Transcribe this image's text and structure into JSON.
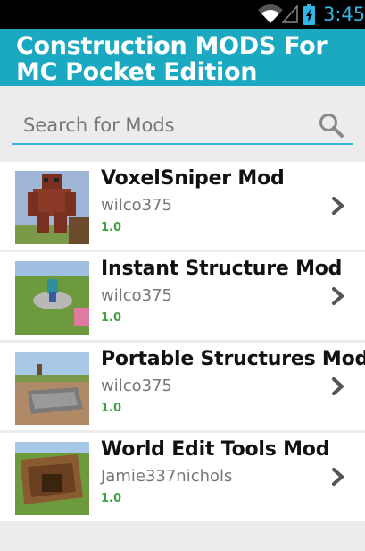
{
  "status_bar": {
    "time": "3:45"
  },
  "app_bar": {
    "title": "Construction MODS For MC Pocket Edition"
  },
  "search": {
    "placeholder": "Search for Mods"
  },
  "mods": [
    {
      "name": "VoxelSniper Mod",
      "author": "wilco375",
      "version": "1.0"
    },
    {
      "name": "Instant Structure Mod",
      "author": "wilco375",
      "version": "1.0"
    },
    {
      "name": "Portable Structures Mod",
      "author": "wilco375",
      "version": "1.0"
    },
    {
      "name": "World Edit Tools Mod",
      "author": "Jamie337nichols",
      "version": "1.0"
    }
  ],
  "colors": {
    "accent": "#1ba8c1",
    "highlight": "#33b5e5",
    "version": "#3fa33f"
  }
}
